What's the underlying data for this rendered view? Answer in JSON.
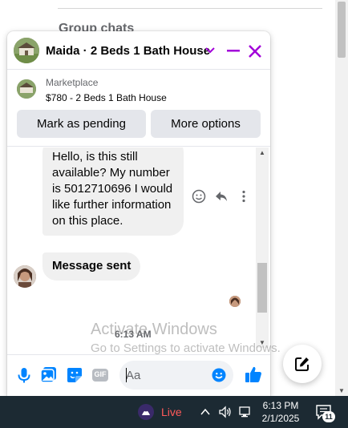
{
  "background": {
    "section_title": "Group chats"
  },
  "chat": {
    "title": "Maida · 2 Beds 1 Bath House",
    "marketplace": {
      "category": "Marketplace",
      "listing_title": "$780 - 2 Beds 1 Bath House",
      "mark_pending_label": "Mark as pending",
      "more_options_label": "More options"
    },
    "messages": [
      {
        "text": "Hello, is this still available? My number is 5012710696 I would like further information on this place."
      },
      {
        "text": "Message sent"
      }
    ],
    "timestamp": "6:13 AM",
    "composer": {
      "placeholder": "Aa",
      "value": ""
    },
    "gif_label": "GIF"
  },
  "watermark": {
    "line1": "Activate Windows",
    "line2": "Go to Settings to activate Windows."
  },
  "taskbar": {
    "live_label": "Live",
    "time": "6:13 PM",
    "date": "2/1/2025",
    "notification_count": "11"
  },
  "colors": {
    "accent": "#0084ff",
    "header_controls": "#a200d9",
    "taskbar": "#1c2a33"
  }
}
